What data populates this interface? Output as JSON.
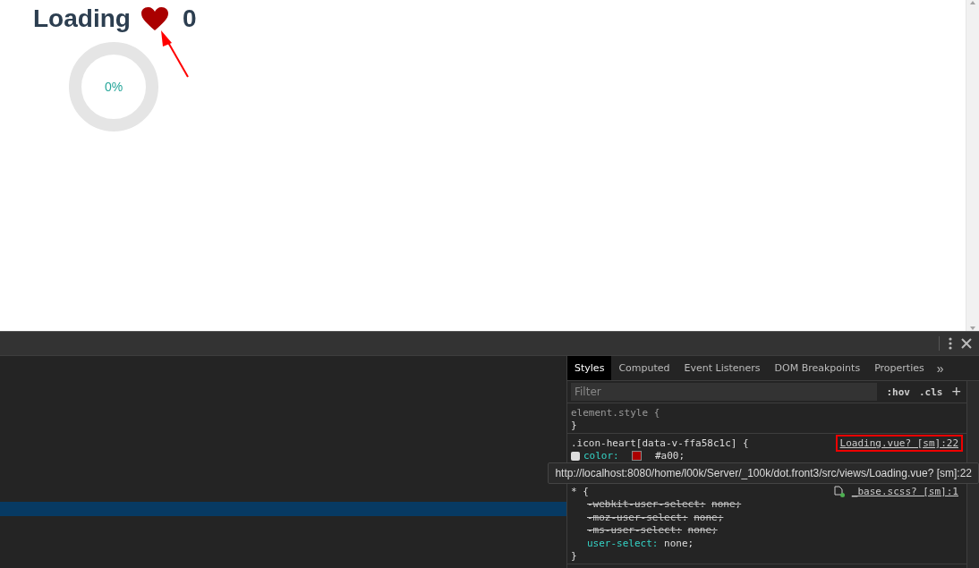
{
  "page": {
    "title": "Loading",
    "like_count": "0",
    "progress": {
      "label": "0%"
    }
  },
  "devtools": {
    "tabs": [
      {
        "label": "Styles",
        "selected": true
      },
      {
        "label": "Computed",
        "selected": false
      },
      {
        "label": "Event Listeners",
        "selected": false
      },
      {
        "label": "DOM Breakpoints",
        "selected": false
      },
      {
        "label": "Properties",
        "selected": false
      }
    ],
    "more_tabs": "»",
    "filter": {
      "placeholder": "Filter"
    },
    "hov": ":hov",
    "cls": ".cls",
    "add": "+",
    "rules": [
      {
        "selector": "element.style {",
        "close": "}"
      },
      {
        "selector": ".icon-heart[data-v-ffa58c1c] {",
        "source": "Loading.vue? [sm]:22",
        "highlighted": true,
        "declarations": [
          {
            "property": "color:",
            "value": "#a00;",
            "checked": true,
            "color": "#aa0000",
            "overridden": false
          }
        ]
      },
      {
        "selector": "* {",
        "source": "_base.scss? [sm]:1",
        "source_icon": true,
        "declarations": [
          {
            "property": "-webkit-user-select:",
            "value": "none;",
            "overridden": true
          },
          {
            "property": "-moz-user-select:",
            "value": "none;",
            "overridden": true
          },
          {
            "property": "-ms-user-select:",
            "value": "none;",
            "overridden": true
          },
          {
            "property": "user-select:",
            "value": "none;",
            "overridden": false
          }
        ],
        "close": "}"
      }
    ],
    "tooltip": "http://localhost:8080/home/l00k/Server/_100k/dot.front3/src/views/Loading.vue? [sm]:22"
  }
}
